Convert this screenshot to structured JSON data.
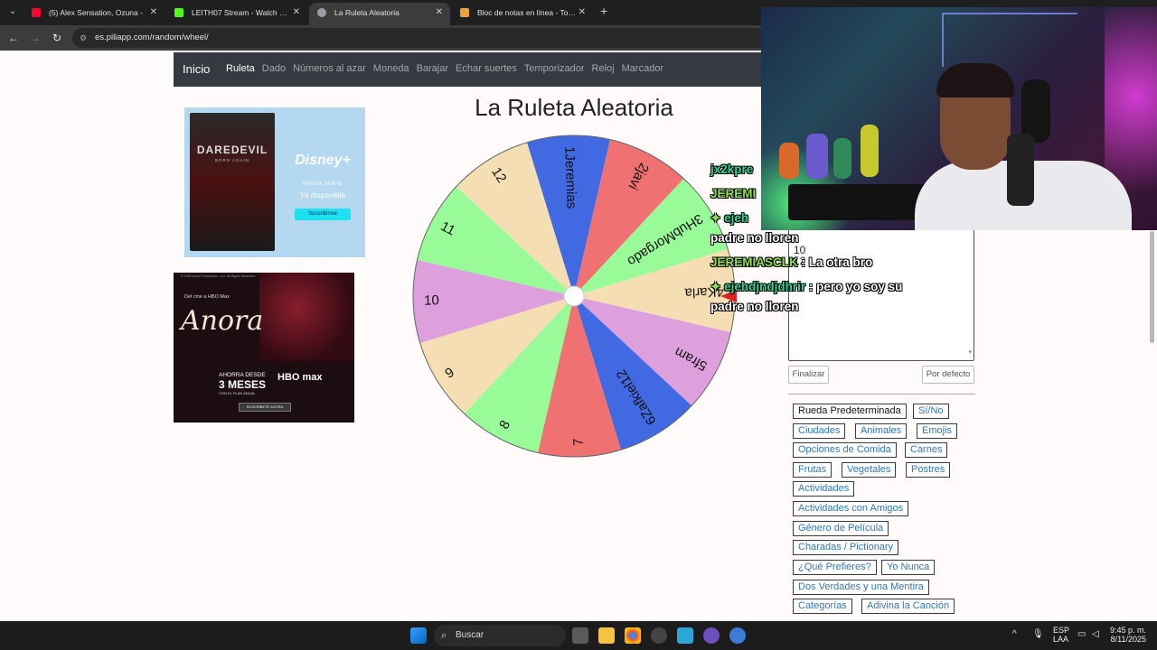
{
  "browser": {
    "tabs": [
      {
        "label": "(5) Alex Sensation, Ozuna -",
        "favicon": "youtube-icon",
        "color": "#ff0033"
      },
      {
        "label": "LEITH07 Stream - Watch Live o",
        "favicon": "kick-icon",
        "color": "#53fc18"
      },
      {
        "label": "La Ruleta Aleatoria",
        "favicon": "globe-icon",
        "color": "#9aa0a6"
      },
      {
        "label": "Bloc de notas en línea - Toma y",
        "favicon": "notepad-icon",
        "color": "#e8a33a"
      }
    ],
    "url": "es.piliapp.com/random/wheel/"
  },
  "site_nav": {
    "brand": "Inicio",
    "links": [
      "Ruleta",
      "Dado",
      "Números al azar",
      "Moneda",
      "Barajar",
      "Echar suertes",
      "Temporizador",
      "Reloj",
      "Marcador"
    ]
  },
  "page_title": "La Ruleta Aleatoria",
  "ads": {
    "ad1": {
      "show": "DAREDEVIL",
      "tagline": "BORN AGAIN",
      "brand": "Disney+",
      "line1": "NUEVA SERIE",
      "line2": "Ya disponible",
      "button": "Suscribirme"
    },
    "ad2": {
      "copyright": "© 2025 Anora Productions, LLC. All Rights Reserved.",
      "line_top": "Del cine a HBO Max",
      "title": "Anora",
      "offer1": "AHORRA DESDE",
      "offer2": "3 MESES",
      "offer3": "CON EL PLAN ANUAL",
      "brand": "HBO max",
      "button": "SUSCRÍBETE AHORA"
    }
  },
  "wheel": {
    "segments": [
      {
        "label": "1Jeremias",
        "color": "#4169e1"
      },
      {
        "label": "2javi",
        "color": "#f07171"
      },
      {
        "label": "3HubMorgado",
        "color": "#98fb98"
      },
      {
        "label": "4Karla",
        "color": "#f5deb3"
      },
      {
        "label": "5fram",
        "color": "#dda0dd"
      },
      {
        "label": "6Zafkiel12",
        "color": "#4169e1"
      },
      {
        "label": "7",
        "color": "#f07171"
      },
      {
        "label": "8",
        "color": "#98fb98"
      },
      {
        "label": "9",
        "color": "#f5deb3"
      },
      {
        "label": "10",
        "color": "#dda0dd"
      },
      {
        "label": "11",
        "color": "#98fb98"
      },
      {
        "label": "12",
        "color": "#f5deb3"
      }
    ],
    "pointer_color": "#e02020"
  },
  "entries_textarea": {
    "lines": [
      "10",
      "12"
    ]
  },
  "buttons": {
    "finish": "Finalizar",
    "default": "Por defecto"
  },
  "presets": [
    "Rueda Predeterminada",
    "Sí/No",
    "Ciudades",
    "Animales",
    "Emojis",
    "Opciones de Comida",
    "Carnes",
    "Frutas",
    "Vegetales",
    "Postres",
    "Actividades",
    "Actividades con Amigos",
    "Género de Película",
    "Charadas / Pictionary",
    "¿Qué Prefieres?",
    "Yo Nunca",
    "Dos Verdades y una Mentira",
    "Categorías",
    "Adivina la Canción"
  ],
  "chat": {
    "line1_user": "jx2kpre",
    "line2_user": "JEREMI",
    "line3_user": "ejeh",
    "line4_text": "padre no lloren",
    "line5_user": "JEREMIASCLK",
    "line5_msg": ": La otra bro",
    "line6_user": "ejehdjndjdhrir",
    "line6_msg": ": pero yo soy su",
    "line7_text": "padre no lloren"
  },
  "taskbar": {
    "search": "Buscar",
    "lang1": "ESP",
    "lang2": "LAA",
    "time": "9:45 p. m.",
    "date": "8/11/2025"
  }
}
